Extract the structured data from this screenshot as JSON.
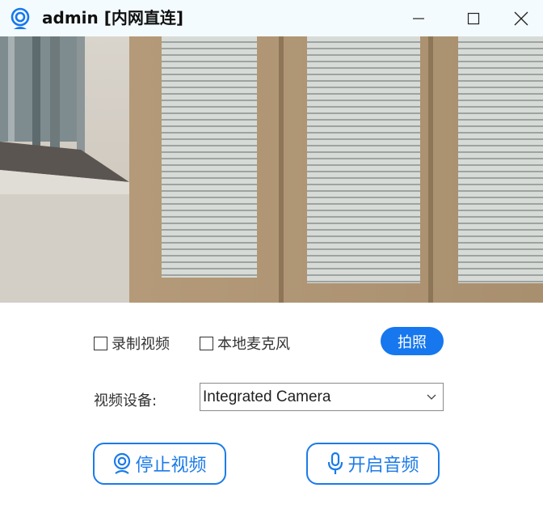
{
  "window": {
    "title": "admin [内网直连]"
  },
  "icons": {
    "app": "webcam-icon",
    "minimize": "minimize-icon",
    "maximize": "maximize-icon",
    "close": "close-icon",
    "camera_button": "webcam-icon",
    "mic_button": "microphone-icon",
    "dropdown": "chevron-down-icon"
  },
  "colors": {
    "accent": "#1677ee",
    "titlebar_bg": "#f4fbfe"
  },
  "controls": {
    "record_video": {
      "label": "录制视频",
      "checked": false
    },
    "local_mic": {
      "label": "本地麦克风",
      "checked": false
    },
    "snapshot_label": "拍照",
    "device_label": "视频设备:",
    "device_value": "Integrated Camera",
    "stop_video_label": "停止视频",
    "start_audio_label": "开启音频"
  }
}
